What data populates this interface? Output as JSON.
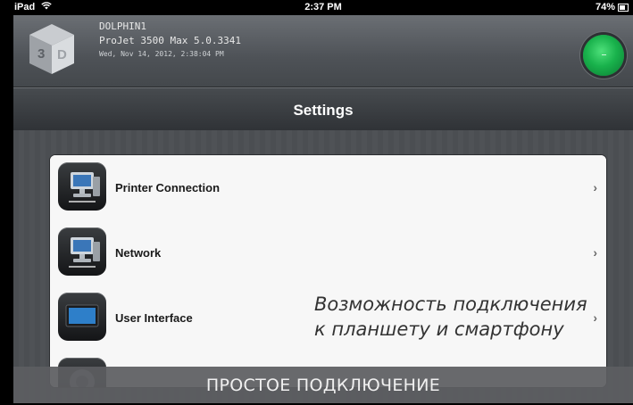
{
  "status_bar": {
    "device": "iPad",
    "time": "2:37 PM",
    "battery": "74%"
  },
  "header": {
    "printer_name": "DOLPHIN1",
    "model": "ProJet 3500 Max 5.0.3341",
    "datetime": "Wed, Nov 14, 2012, 2:38:04 PM",
    "status_color": "#19b24c"
  },
  "nav": {
    "title": "Settings"
  },
  "settings": {
    "items": [
      {
        "label": "Printer Connection",
        "icon": "computer-icon"
      },
      {
        "label": "Network",
        "icon": "computer-icon"
      },
      {
        "label": "User Interface",
        "icon": "monitor-icon"
      },
      {
        "label": "",
        "icon": "settings-icon"
      }
    ]
  },
  "annotation": {
    "line1": "Возможность подключения",
    "line2": "к планшету и смартфону"
  },
  "footer": {
    "caption": "ПРОСТОЕ ПОДКЛЮЧЕНИЕ"
  }
}
